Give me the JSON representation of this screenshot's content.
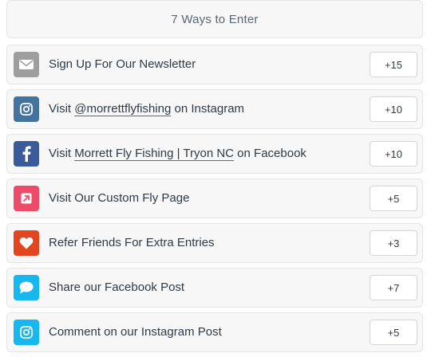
{
  "header": {
    "title": "7 Ways to Enter"
  },
  "entries": [
    {
      "icon": "envelope-icon",
      "color": "#9e9e9e",
      "label": "Sign Up For Our Newsletter",
      "points": "+15"
    },
    {
      "icon": "instagram-icon",
      "color": "#43739e",
      "label_pre": "Visit ",
      "label_link": "@morrettflyfishing",
      "label_post": " on Instagram",
      "points": "+10"
    },
    {
      "icon": "facebook-icon",
      "color": "#3b5a9a",
      "label_pre": "Visit ",
      "label_link": "Morrett Fly Fishing | Tryon NC",
      "label_post": " on Facebook",
      "points": "+10"
    },
    {
      "icon": "external-link-icon",
      "color": "#ee4a6a",
      "label": "Visit Our Custom Fly Page",
      "points": "+5"
    },
    {
      "icon": "heart-icon",
      "color": "#e2451f",
      "label": "Refer Friends For Extra Entries",
      "points": "+3"
    },
    {
      "icon": "speech-bubble-icon",
      "color": "#17b7ef",
      "label": "Share our Facebook Post",
      "points": "+7"
    },
    {
      "icon": "instagram-icon",
      "color": "#17b7ef",
      "label": "Comment on our Instagram Post",
      "points": "+5"
    }
  ]
}
